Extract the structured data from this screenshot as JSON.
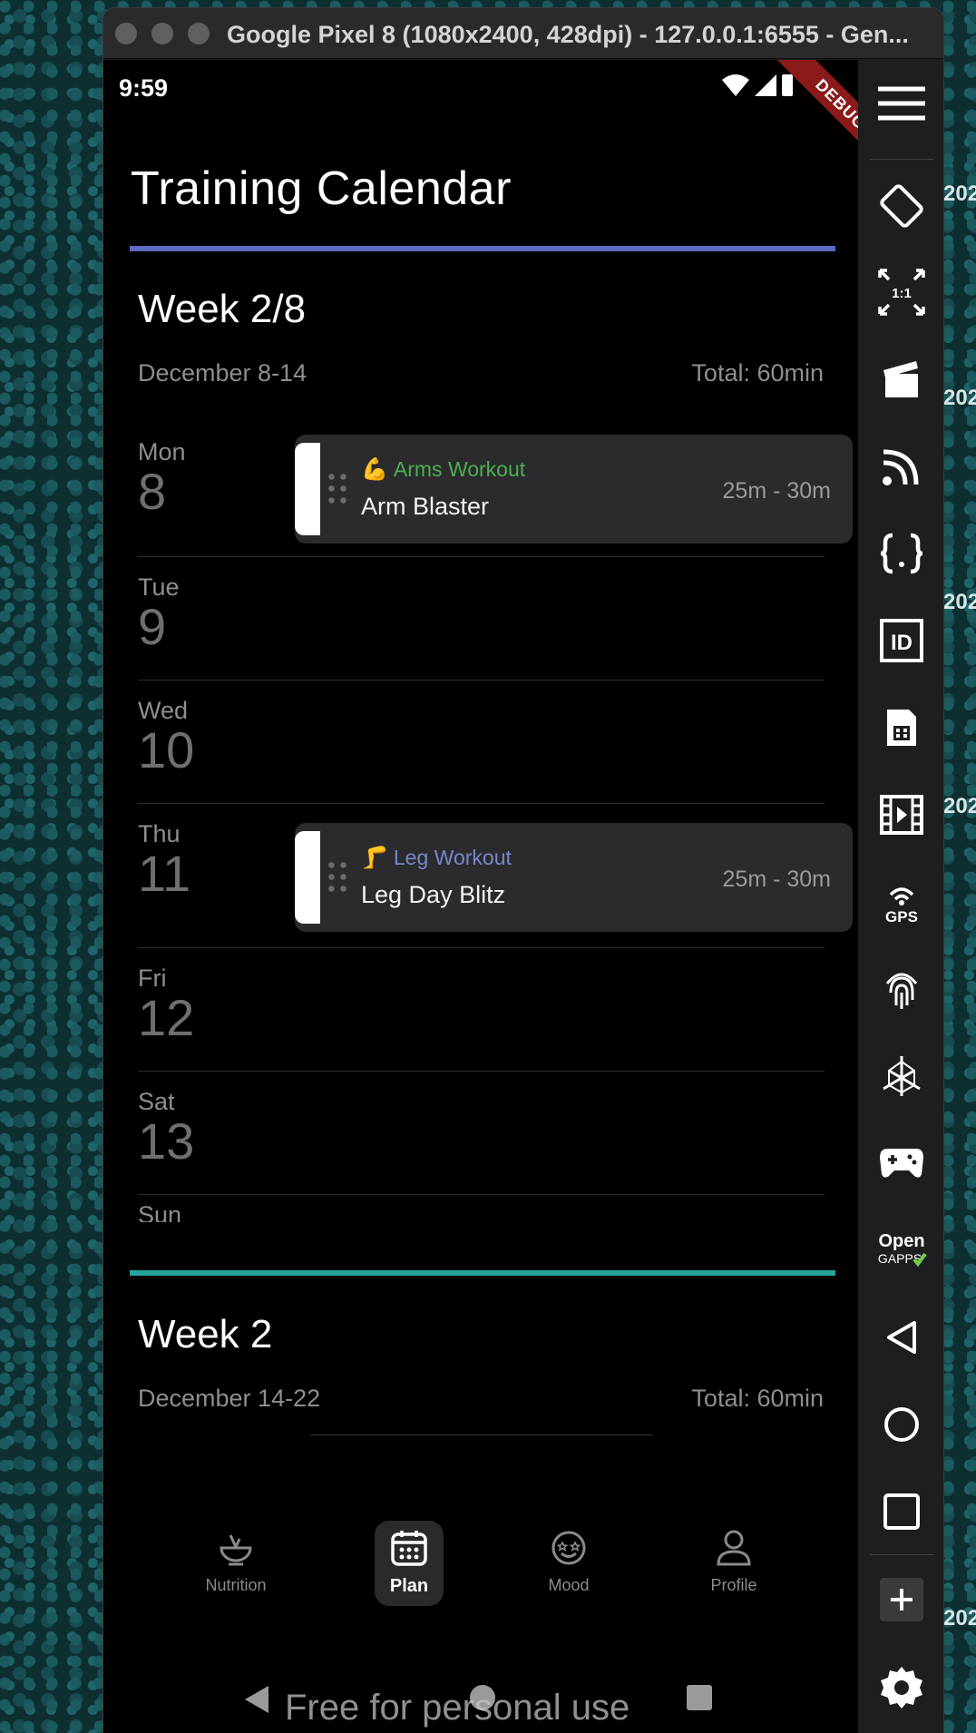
{
  "emulator": {
    "title": "Google Pixel 8 (1080x2400, 428dpi) - 127.0.0.1:6555 - Gen..."
  },
  "status_bar": {
    "time": "9:59",
    "debug_banner": "DEBUG"
  },
  "page": {
    "title": "Training Calendar"
  },
  "weeks": [
    {
      "title": "Week 2/8",
      "range": "December 8-14",
      "total": "Total: 60min",
      "accent_color": "#5c6bc0",
      "days": [
        {
          "name": "Mon",
          "num": "8"
        },
        {
          "name": "Tue",
          "num": "9"
        },
        {
          "name": "Wed",
          "num": "10"
        },
        {
          "name": "Thu",
          "num": "11"
        },
        {
          "name": "Fri",
          "num": "12"
        },
        {
          "name": "Sat",
          "num": "13"
        },
        {
          "name": "Sun",
          "num": ""
        }
      ],
      "workouts": [
        {
          "day": "Mon",
          "category": "Arms Workout",
          "category_emoji": "💪",
          "category_color": "#4caf50",
          "name": "Arm Blaster",
          "duration": "25m - 30m"
        },
        {
          "day": "Thu",
          "category": "Leg Workout",
          "category_emoji": "🦵",
          "category_color": "#7986cb",
          "name": "Leg Day Blitz",
          "duration": "25m - 30m"
        }
      ]
    },
    {
      "title": "Week 2",
      "range": "December 14-22",
      "total": "Total: 60min",
      "accent_color": "#26a69a"
    }
  ],
  "bottom_nav": {
    "items": [
      {
        "label": "Nutrition",
        "icon": "nutrition-bowl-icon",
        "active": false
      },
      {
        "label": "Plan",
        "icon": "calendar-icon",
        "active": true
      },
      {
        "label": "Mood",
        "icon": "mood-face-icon",
        "active": false
      },
      {
        "label": "Profile",
        "icon": "person-icon",
        "active": false
      }
    ]
  },
  "watermark": "Free for personal use",
  "emulator_toolbar": {
    "buttons": [
      "menu-icon",
      "rotate-icon",
      "resize-1to1-icon",
      "screen-record-icon",
      "cast-icon",
      "json-icon",
      "device-id-icon",
      "sim-card-icon",
      "media-icon",
      "gps-icon",
      "fingerprint-icon",
      "sensors-icon",
      "gamepad-icon",
      "open-gapps-icon",
      "back-icon",
      "home-icon",
      "recents-icon",
      "add-icon",
      "settings-icon"
    ],
    "resize_label": "1:1",
    "gps_label": "GPS",
    "id_label": "ID",
    "gapps_label_top": "Open",
    "gapps_label_bottom": "GAPPS"
  },
  "background": {
    "edge_text": "202"
  }
}
